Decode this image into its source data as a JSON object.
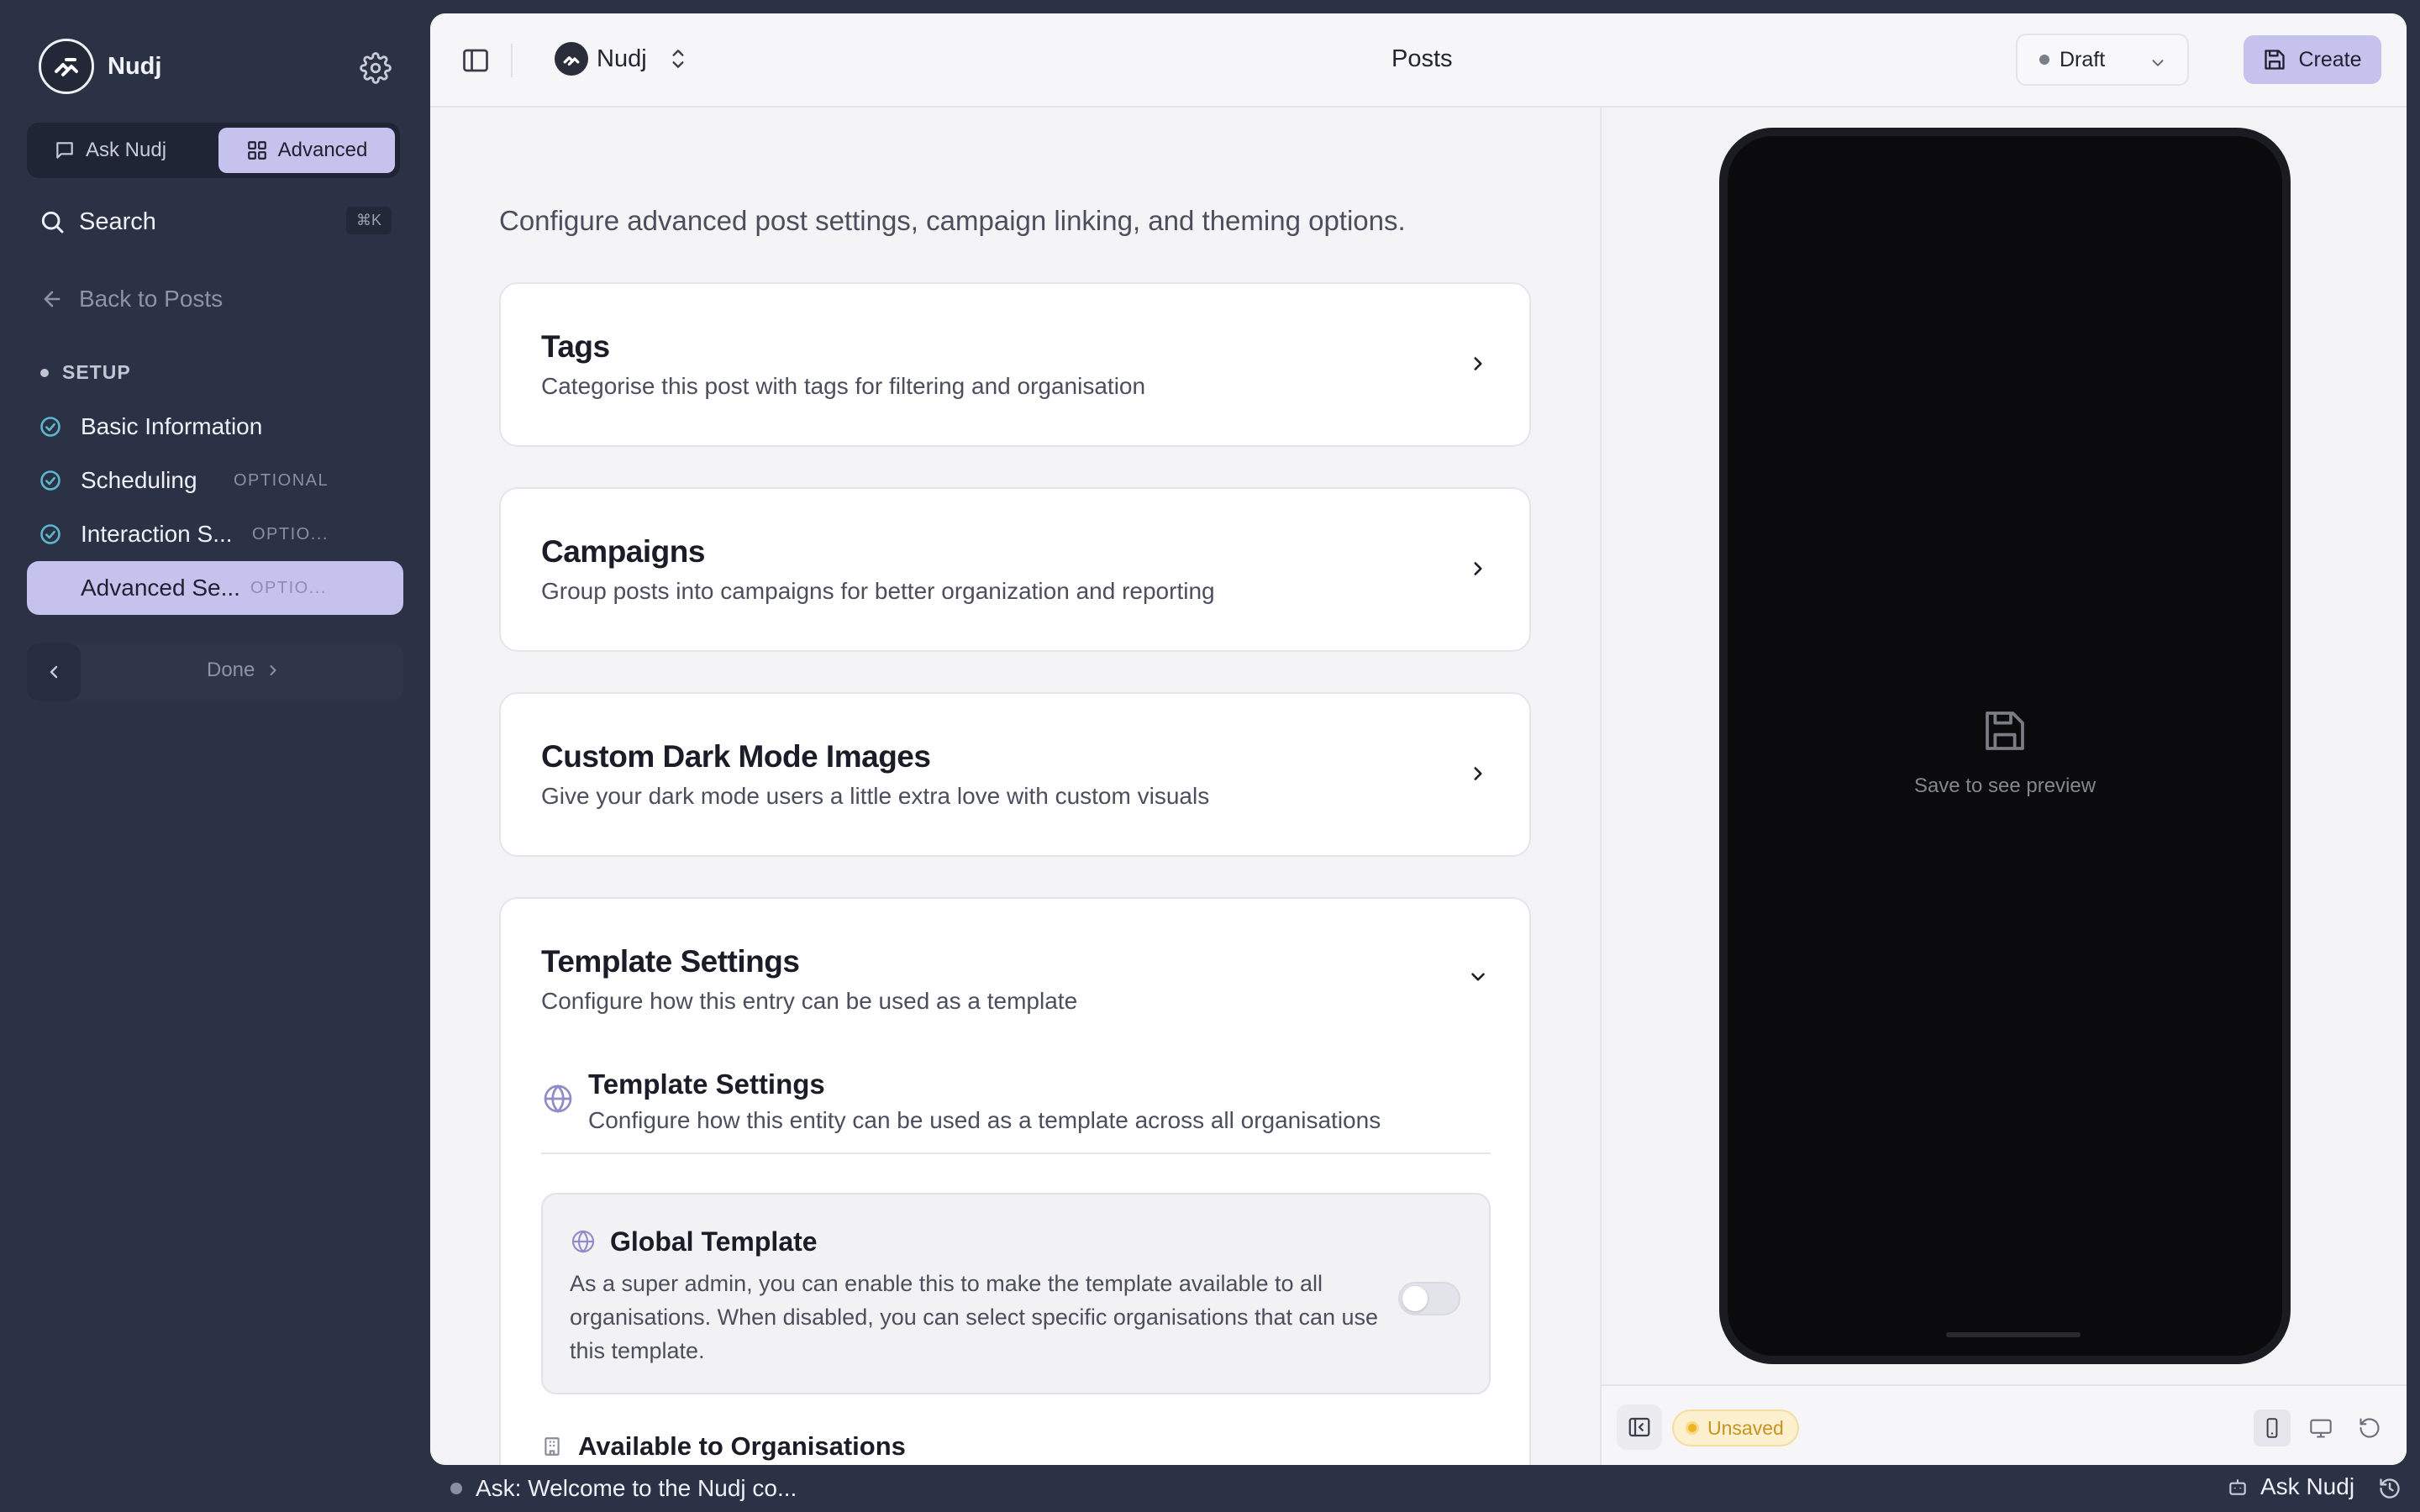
{
  "colors": {
    "sidebar_bg": "#2b3245",
    "accent": "#c5c3ee",
    "check": "#5fb6d0",
    "unsaved": "#f0b323"
  },
  "sidebar": {
    "brand_name": "Nudj",
    "mode_tabs": [
      {
        "label": "Ask Nudj",
        "icon": "chat-bubble-icon",
        "active": false
      },
      {
        "label": "Advanced",
        "icon": "grid-icon",
        "active": true
      }
    ],
    "search": {
      "label": "Search",
      "shortcut": "⌘K"
    },
    "back_label": "Back to Posts",
    "section_label": "SETUP",
    "steps": [
      {
        "label": "Basic Information",
        "tag": "",
        "complete": true
      },
      {
        "label": "Scheduling",
        "tag": "OPTIONAL",
        "complete": true
      },
      {
        "label": "Interaction S...",
        "tag": "OPTIO...",
        "complete": true
      },
      {
        "label": "Advanced Se...",
        "tag": "OPTIO...",
        "complete": false,
        "active": true
      }
    ],
    "pager": {
      "next_label": "Done"
    }
  },
  "topbar": {
    "org_name": "Nudj",
    "title": "Posts",
    "status": "Draft",
    "create_label": "Create"
  },
  "editor": {
    "intro": "Configure advanced post settings, campaign linking, and theming options.",
    "cards": [
      {
        "title": "Tags",
        "subtitle": "Categorise this post with tags for filtering and organisation"
      },
      {
        "title": "Campaigns",
        "subtitle": "Group posts into campaigns for better organization and reporting"
      },
      {
        "title": "Custom Dark Mode Images",
        "subtitle": "Give your dark mode users a little extra love with custom visuals"
      }
    ],
    "template": {
      "title": "Template Settings",
      "subtitle": "Configure how this entry can be used as a template",
      "inner_title": "Template Settings",
      "inner_subtitle": "Configure how this entity can be used as a template across all organisations",
      "global": {
        "title": "Global Template",
        "text": "As a super admin, you can enable this to make the template available to all organisations. When disabled, you can select specific organisations that can use this template.",
        "enabled": false
      },
      "available_label": "Available to Organisations"
    }
  },
  "preview": {
    "placeholder": "Save to see preview",
    "unsaved_label": "Unsaved"
  },
  "statusbar": {
    "ask_text": "Ask: Welcome to the Nudj co...",
    "ask_button": "Ask Nudj"
  }
}
